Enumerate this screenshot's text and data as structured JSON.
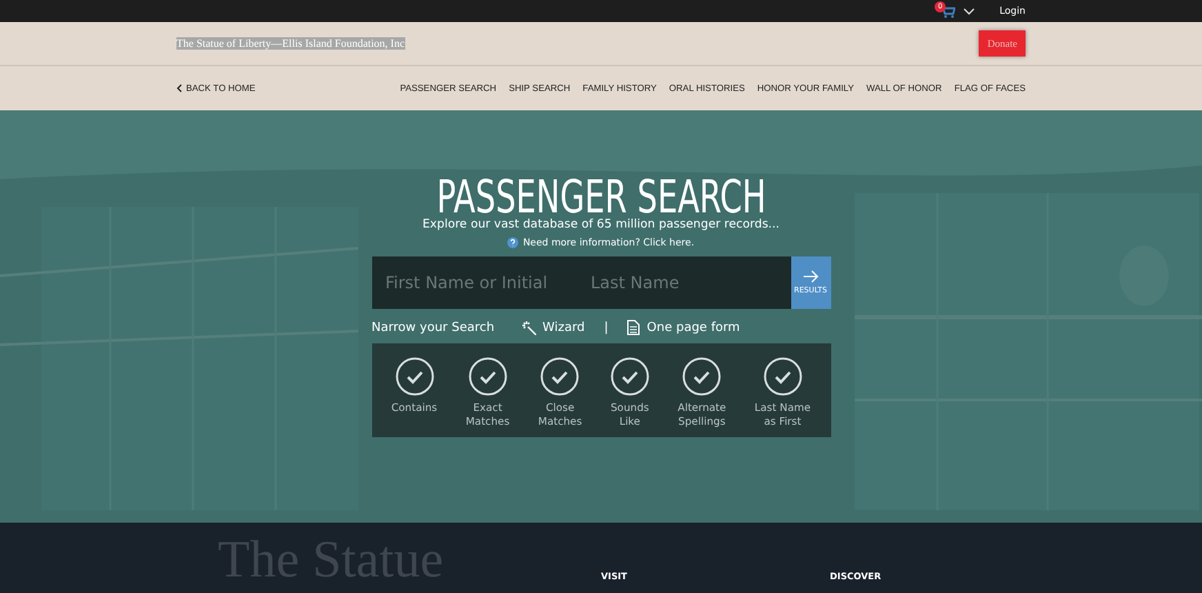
{
  "topbar": {
    "cart_count": "0",
    "login": "Login"
  },
  "header": {
    "site_title": "The Statue of Liberty—Ellis Island Foundation, Inc",
    "donate": "Donate"
  },
  "nav": {
    "back": "BACK TO HOME",
    "items": [
      {
        "label": "PASSENGER SEARCH",
        "selected": false
      },
      {
        "label": "SHIP SEARCH",
        "selected": false
      },
      {
        "label": "FAMILY HISTORY",
        "selected": false
      },
      {
        "label": "ORAL HISTORIES",
        "selected": false
      },
      {
        "label": "HONOR YOUR FAMILY",
        "selected": false
      },
      {
        "label": "WALL OF HONOR",
        "selected": false
      },
      {
        "label": "FLAG OF FACES",
        "selected": false
      }
    ]
  },
  "hero": {
    "kind": "picture",
    "title": "PASSENGER SEARCH",
    "subtitle": "Explore our vast database of 65 million passenger records...",
    "help_link": "Need more information? Click here.",
    "search": {
      "first_placeholder": "First Name or Initial",
      "last_placeholder": "Last Name",
      "button": "RESULTS"
    },
    "narrow_label": "Narrow your Search",
    "wizard": "Wizard",
    "separator": "|",
    "one_page_form": "One page form",
    "options": [
      {
        "label": "Contains"
      },
      {
        "label": "Exact\nMatches"
      },
      {
        "label": "Close\nMatches"
      },
      {
        "label": "Sounds\nLike"
      },
      {
        "label": "Alternate\nSpellings"
      },
      {
        "label": "Last Name\nas First"
      }
    ]
  },
  "footer": {
    "logo_text": "The Statue",
    "columns": [
      "VISIT",
      "DISCOVER"
    ]
  }
}
